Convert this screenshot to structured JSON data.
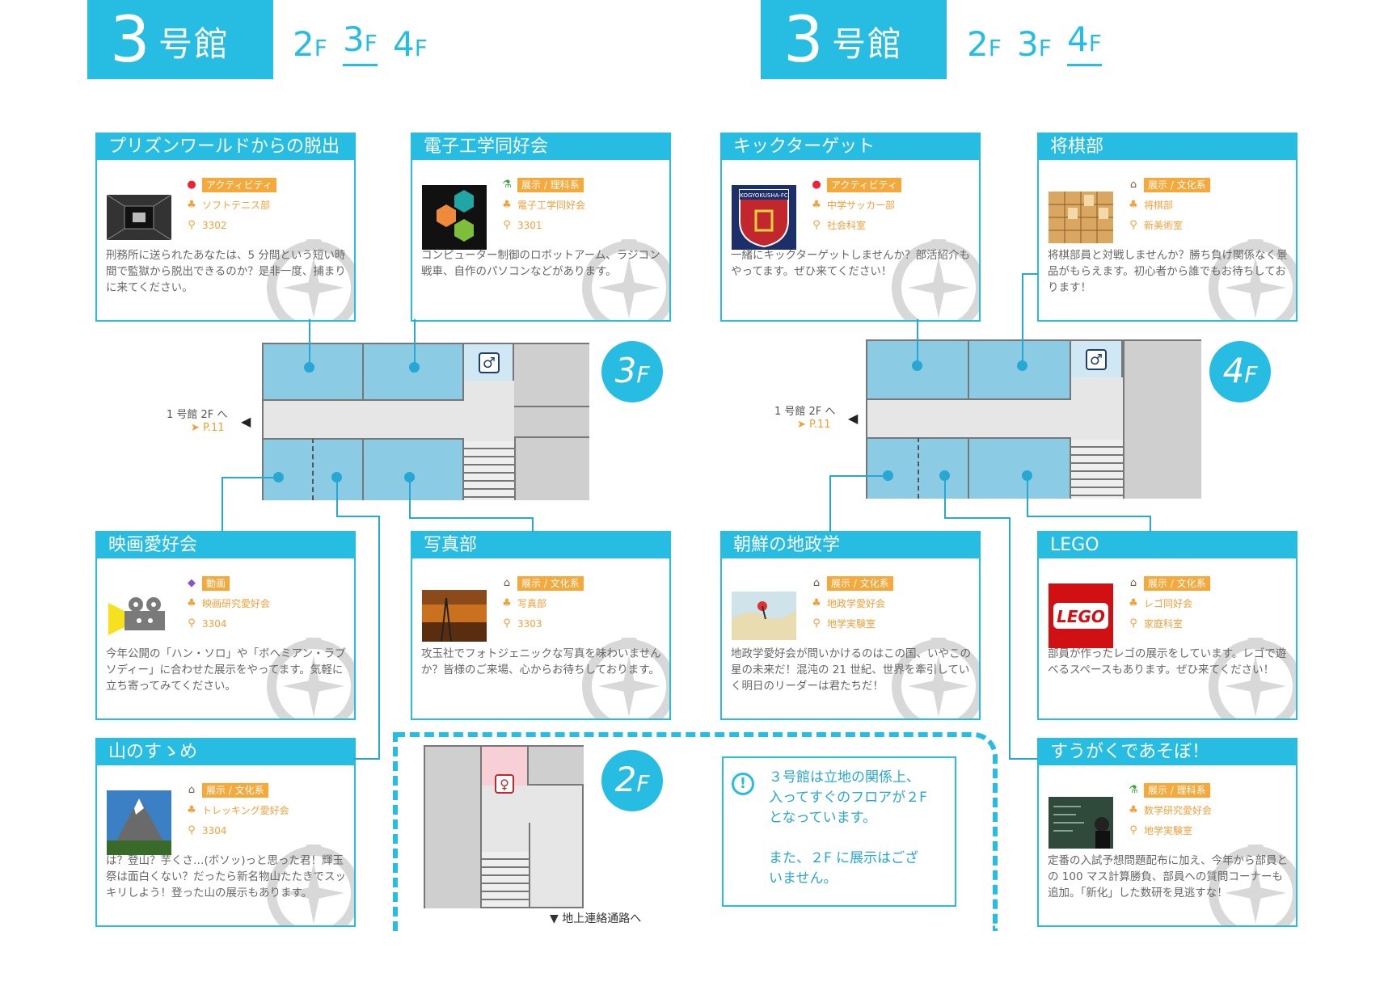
{
  "left": {
    "building_number": "3",
    "building_label": "号館",
    "floors": [
      {
        "n": "2",
        "u": "F"
      },
      {
        "n": "3",
        "u": "F"
      },
      {
        "n": "4",
        "u": "F"
      }
    ],
    "current_floor": "3F",
    "plan_badge": {
      "n": "3",
      "u": "F"
    },
    "nav_note": "1 号館 2F へ",
    "nav_page": "P.11"
  },
  "right": {
    "building_number": "3",
    "building_label": "号館",
    "floors": [
      {
        "n": "2",
        "u": "F"
      },
      {
        "n": "3",
        "u": "F"
      },
      {
        "n": "4",
        "u": "F"
      }
    ],
    "current_floor": "4F",
    "plan_badge": {
      "n": "4",
      "u": "F"
    },
    "nav_note": "1 号館 2F へ",
    "nav_page": "P.11"
  },
  "cards": [
    {
      "title": "プリズンワールドからの脱出",
      "category": "アクティビティ",
      "category_icon": "ping-pong-icon",
      "org": "ソフトテニス部",
      "room": "3302",
      "desc": "刑務所に送られたあなたは、5 分間という短い時間で監獄から脱出できるのか？是非一度、捕まりに来てください。",
      "photo": "prison-corridor"
    },
    {
      "title": "電子工学同好会",
      "category": "展示 / 理科系",
      "category_icon": "flask-icon",
      "org": "電子工学同好会",
      "room": "3301",
      "desc": "コンピューター制御のロボットアーム、ラジコン戦車、自作のパソコンなどがあります。",
      "photo": "hexagon-logo"
    },
    {
      "title": "映画愛好会",
      "category": "動画",
      "category_icon": "video-tag-icon",
      "org": "映画研究愛好会",
      "room": "3304",
      "desc": "今年公開の「ハン・ソロ」や「ボヘミアン・ラプソディー」に合わせた展示をやってます。気軽に立ち寄ってみてください。",
      "photo": "film-projector"
    },
    {
      "title": "写真部",
      "category": "展示 / 文化系",
      "category_icon": "museum-icon",
      "org": "写真部",
      "room": "3303",
      "desc": "攻玉社でフォトジェニックな写真を味わいませんか？皆様のご来場、心からお待ちしております。",
      "photo": "sunset-tower"
    },
    {
      "title": "山のすゝめ",
      "category": "展示 / 文化系",
      "category_icon": "museum-icon",
      "org": "トレッキング愛好会",
      "room": "3304",
      "desc": "は？登山？芋くさ…(ボソッ)っと思った君！輝玉祭は面白くない？だったら新名物山たたきでスッキリしよう！登った山の展示もあります。",
      "photo": "matterhorn"
    },
    {
      "title": "キックターゲット",
      "category": "アクティビティ",
      "category_icon": "ping-pong-icon",
      "org": "中学サッカー部",
      "room": "社会科室",
      "desc": "一緒にキックターゲットしませんか？部活紹介もやってます。ぜひ来てください！",
      "photo": "soccer-crest"
    },
    {
      "title": "将棋部",
      "category": "展示 / 文化系",
      "category_icon": "museum-icon",
      "org": "将棋部",
      "room": "新美術室",
      "desc": "将棋部員と対戦しませんか？勝ち負け関係なく景品がもらえます。初心者から誰でもお待ちしております！",
      "photo": "shogi-board"
    },
    {
      "title": "朝鮮の地政学",
      "category": "展示 / 文化系",
      "category_icon": "museum-icon",
      "org": "地政学愛好会",
      "room": "地学実験室",
      "desc": "地政学愛好会が問いかけるのはこの国、いやこの星の未来だ！混沌の 21 世紀、世界を牽引していく明日のリーダーは君たちだ！",
      "photo": "map-pin"
    },
    {
      "title": "LEGO",
      "category": "展示 / 文化系",
      "category_icon": "museum-icon",
      "org": "レゴ同好会",
      "room": "家庭科室",
      "desc": "部員が作ったレゴの展示をしています。レゴで遊べるスペースもあります。ぜひ来てください！",
      "photo": "lego-logo"
    },
    {
      "title": "すうがくであそぼ！",
      "category": "展示 / 理科系",
      "category_icon": "flask-icon",
      "org": "数学研究愛好会",
      "room": "地学実験室",
      "desc": "定番の入試予想問題配布に加え、今年から部員との 100 マス計算勝負、部員への質問コーナーも追加。「新化」した数研を見逃すな！",
      "photo": "chalkboard"
    }
  ],
  "lego_text": "LEGO",
  "soccer_text": "KOGYOKUSHA-FC",
  "floor2": {
    "badge": {
      "n": "2",
      "u": "F"
    },
    "exit_label": "▼ 地上連絡通路へ",
    "notice_line1": "３号館は立地の関係上、",
    "notice_line2": "入ってすぐのフロアが２F",
    "notice_line3": "となっています。",
    "notice_line4": "また、２F に展示はござ",
    "notice_line5": "いません。",
    "notice_icon": "exclamation-circle-icon"
  },
  "colors": {
    "accent": "#27bde3",
    "tag": "#f5a93b",
    "room": "#8ccbe4",
    "gray": "#cfcfcf"
  }
}
